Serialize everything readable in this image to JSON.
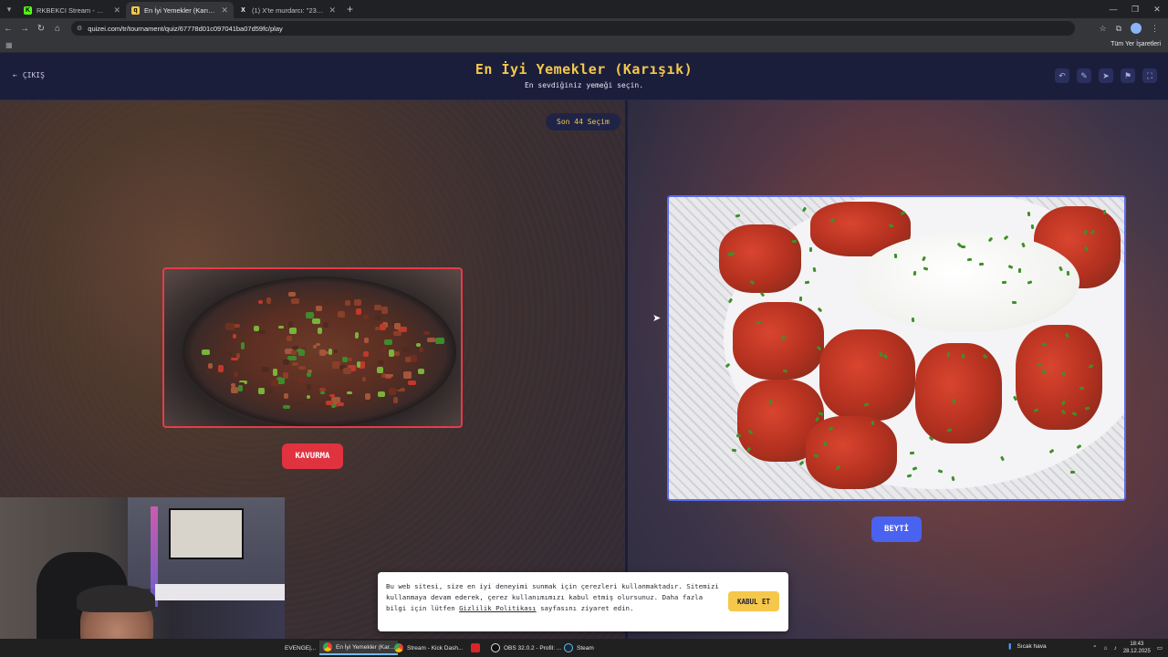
{
  "browser": {
    "tabs": [
      {
        "title": "RKBEKCI Stream - Watch Live o",
        "favicon": "kick-icon",
        "color": "#53fc18",
        "active": false
      },
      {
        "title": "En İyi Yemekler (Karışık) - Tier L",
        "favicon": "quizei-icon",
        "color": "#f5c84b",
        "active": true
      },
      {
        "title": "(1) X'te murdarcı: \"23/24de nas",
        "favicon": "x-icon",
        "color": "#ffffff",
        "active": false
      }
    ],
    "url": "quizei.com/tr/tournament/quiz/67778d01c097041ba07d59fc/play",
    "bookmarks_all": "Tüm Yer İşaretleri"
  },
  "header": {
    "exit_label": "ÇIKIŞ",
    "title": "En İyi Yemekler (Karışık)",
    "subtitle": "En sevdiğiniz yemeği seçin.",
    "icons": [
      "undo-icon",
      "edit-icon",
      "share-icon",
      "flag-icon",
      "fullscreen-icon"
    ]
  },
  "game": {
    "round_badge": "Son 44 Seçim",
    "left_option": {
      "label": "KAVURMA",
      "accent": "#e0323f"
    },
    "right_option": {
      "label": "BEYTİ",
      "accent": "#4a62f0"
    }
  },
  "cookie": {
    "text_before": "Bu web sitesi, size en iyi deneyimi sunmak için çerezleri kullanmaktadır. Sitemizi kullanmaya devam ederek, çerez kullanımımızı kabul etmiş olursunuz. Daha fazla bilgi için lütfen ",
    "link": "Gizlilik Politikası",
    "text_after": " sayfasını ziyaret edin.",
    "accept": "KABUL ET"
  },
  "taskbar": {
    "items": [
      {
        "label": "EVENGE|...",
        "active": false
      },
      {
        "label": "En İyi Yemekler (Kar...",
        "active": true
      },
      {
        "label": "Stream - Kick Dash...",
        "active": false
      },
      {
        "label": "",
        "active": false
      },
      {
        "label": "OBS 32.0.2 - Profil: ...",
        "active": false
      },
      {
        "label": "Steam",
        "active": false
      }
    ],
    "weather": "Sıcak hava",
    "time": "18:43",
    "date": "28.12.2025"
  }
}
